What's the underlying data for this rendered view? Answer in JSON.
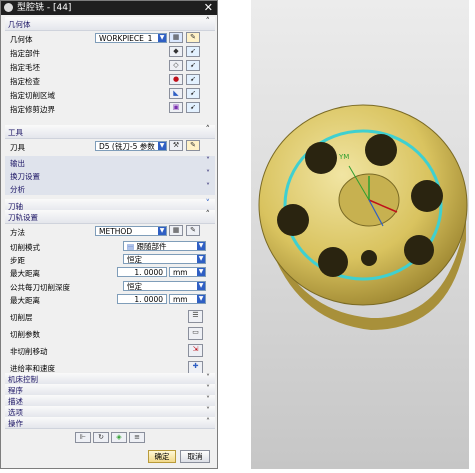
{
  "window": {
    "title": "型腔铣 - [44]"
  },
  "geometry": {
    "section_label": "几何体",
    "geometry_label": "几何体",
    "geometry_value": "WORKPIECE_1",
    "specify_part": "指定部件",
    "specify_blank": "指定毛坯",
    "specify_check": "指定检查",
    "specify_cut_area": "指定切削区域",
    "specify_trim": "指定修剪边界"
  },
  "tool": {
    "section_label": "工具",
    "tool_label": "刀具",
    "tool_value": "D5 (铣刀-5 参数",
    "output": "输出",
    "tool_change": "换刀设置",
    "analysis": "分析"
  },
  "axis": {
    "section_label": "刀轴"
  },
  "path_settings": {
    "section_label": "刀轨设置",
    "method_label": "方法",
    "method_value": "METHOD",
    "cut_mode_label": "切削模式",
    "cut_mode_value": "跟随部件",
    "stepover_label": "步距",
    "stepover_value": "恒定",
    "max_distance_label": "最大距离",
    "max_distance_value": "1. 0000",
    "max_distance_unit": "mm",
    "depth_label": "公共每刀切削深度",
    "depth_value": "恒定",
    "max_distance2_label": "最大距离",
    "max_distance2_value": "1. 0000",
    "max_distance2_unit": "mm",
    "cut_levels": "切削层",
    "cut_params": "切削参数",
    "non_cut_moves": "非切削移动",
    "feeds_speeds": "进给率和速度"
  },
  "collapsed_sections": [
    "机床控制",
    "程序",
    "描述",
    "选项"
  ],
  "actions": {
    "section_label": "操作",
    "ok": "确定",
    "cancel": "取消"
  },
  "viewport": {
    "axis_label": "YM"
  },
  "colors": {
    "accent": "#2f5fc4",
    "part": "#d9c35f",
    "toolpath": "#3fd0d0",
    "section_text": "#1b1464"
  }
}
